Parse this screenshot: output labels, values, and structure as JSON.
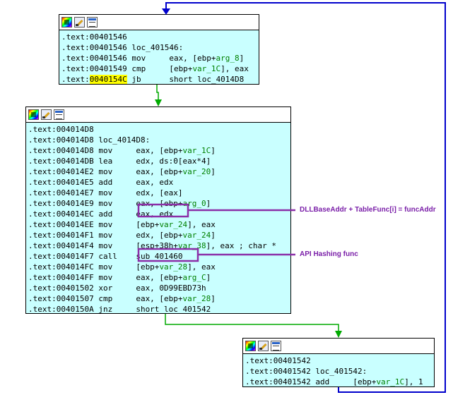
{
  "colors": {
    "node_bg": "#c9ffff",
    "edge_blue": "#0000cc",
    "edge_green": "#00aa00",
    "annotation_purple": "#8b2fa8",
    "address_highlight": "#ffff00",
    "variable_green": "#008000"
  },
  "node_header_icons": [
    "graph-overview-icon",
    "edit-node-icon",
    "xrefs-icon"
  ],
  "nodes": [
    {
      "name": "block-401546",
      "lines": [
        [
          {
            "t": ".text:00401546"
          }
        ],
        [
          {
            "t": ".text:00401546 loc_401546:"
          }
        ],
        [
          {
            "t": ".text:00401546 mov     eax, [ebp+"
          },
          {
            "t": "arg_8",
            "c": "var"
          },
          {
            "t": "]"
          }
        ],
        [
          {
            "t": ".text:00401549 cmp     [ebp+"
          },
          {
            "t": "var_1C",
            "c": "var"
          },
          {
            "t": "], eax"
          }
        ],
        [
          {
            "t": ".text:"
          },
          {
            "t": "0040154C",
            "c": "hl"
          },
          {
            "t": " jb      short loc_4014D8"
          }
        ]
      ]
    },
    {
      "name": "block-4014d8",
      "lines": [
        [
          {
            "t": ".text:004014D8"
          }
        ],
        [
          {
            "t": ".text:004014D8 loc_4014D8:"
          }
        ],
        [
          {
            "t": ".text:004014D8 mov     eax, [ebp+"
          },
          {
            "t": "var_1C",
            "c": "var"
          },
          {
            "t": "]"
          }
        ],
        [
          {
            "t": ".text:004014DB lea     edx, ds:0[eax*4]"
          }
        ],
        [
          {
            "t": ".text:004014E2 mov     eax, [ebp+"
          },
          {
            "t": "var_20",
            "c": "var"
          },
          {
            "t": "]"
          }
        ],
        [
          {
            "t": ".text:004014E5 add     eax, edx"
          }
        ],
        [
          {
            "t": ".text:004014E7 mov     edx, [eax]"
          }
        ],
        [
          {
            "t": ".text:004014E9 mov     eax, [ebp+"
          },
          {
            "t": "arg_0",
            "c": "var"
          },
          {
            "t": "]"
          }
        ],
        [
          {
            "t": ".text:004014EC add     eax, edx"
          }
        ],
        [
          {
            "t": ".text:004014EE mov     [ebp+"
          },
          {
            "t": "var_24",
            "c": "var"
          },
          {
            "t": "], eax"
          }
        ],
        [
          {
            "t": ".text:004014F1 mov     edx, [ebp+"
          },
          {
            "t": "var_24",
            "c": "var"
          },
          {
            "t": "]"
          }
        ],
        [
          {
            "t": ".text:004014F4 mov     [esp+38h+"
          },
          {
            "t": "var_38",
            "c": "var"
          },
          {
            "t": "], eax ; char *"
          }
        ],
        [
          {
            "t": ".text:004014F7 call    sub_401460"
          }
        ],
        [
          {
            "t": ".text:004014FC mov     [ebp+"
          },
          {
            "t": "var_28",
            "c": "var"
          },
          {
            "t": "], eax"
          }
        ],
        [
          {
            "t": ".text:004014FF mov     eax, [ebp+"
          },
          {
            "t": "arg_C",
            "c": "var"
          },
          {
            "t": "]"
          }
        ],
        [
          {
            "t": ".text:00401502 xor     eax, 0D99EBD73h"
          }
        ],
        [
          {
            "t": ".text:00401507 cmp     eax, [ebp+"
          },
          {
            "t": "var_28",
            "c": "var"
          },
          {
            "t": "]"
          }
        ],
        [
          {
            "t": ".text:0040150A jnz     short loc_401542"
          }
        ]
      ]
    },
    {
      "name": "block-401542",
      "lines": [
        [
          {
            "t": ".text:00401542"
          }
        ],
        [
          {
            "t": ".text:00401542 loc_401542:"
          }
        ],
        [
          {
            "t": ".text:00401542 add     [ebp+"
          },
          {
            "t": "var_1C",
            "c": "var"
          },
          {
            "t": "], 1"
          }
        ]
      ]
    }
  ],
  "annotations": [
    {
      "name": "annotation-dll-base-addr",
      "text": "DLLBaseAddr + TableFunc[i] = funcAddr"
    },
    {
      "name": "annotation-api-hashing",
      "text": "API Hashing func"
    }
  ]
}
